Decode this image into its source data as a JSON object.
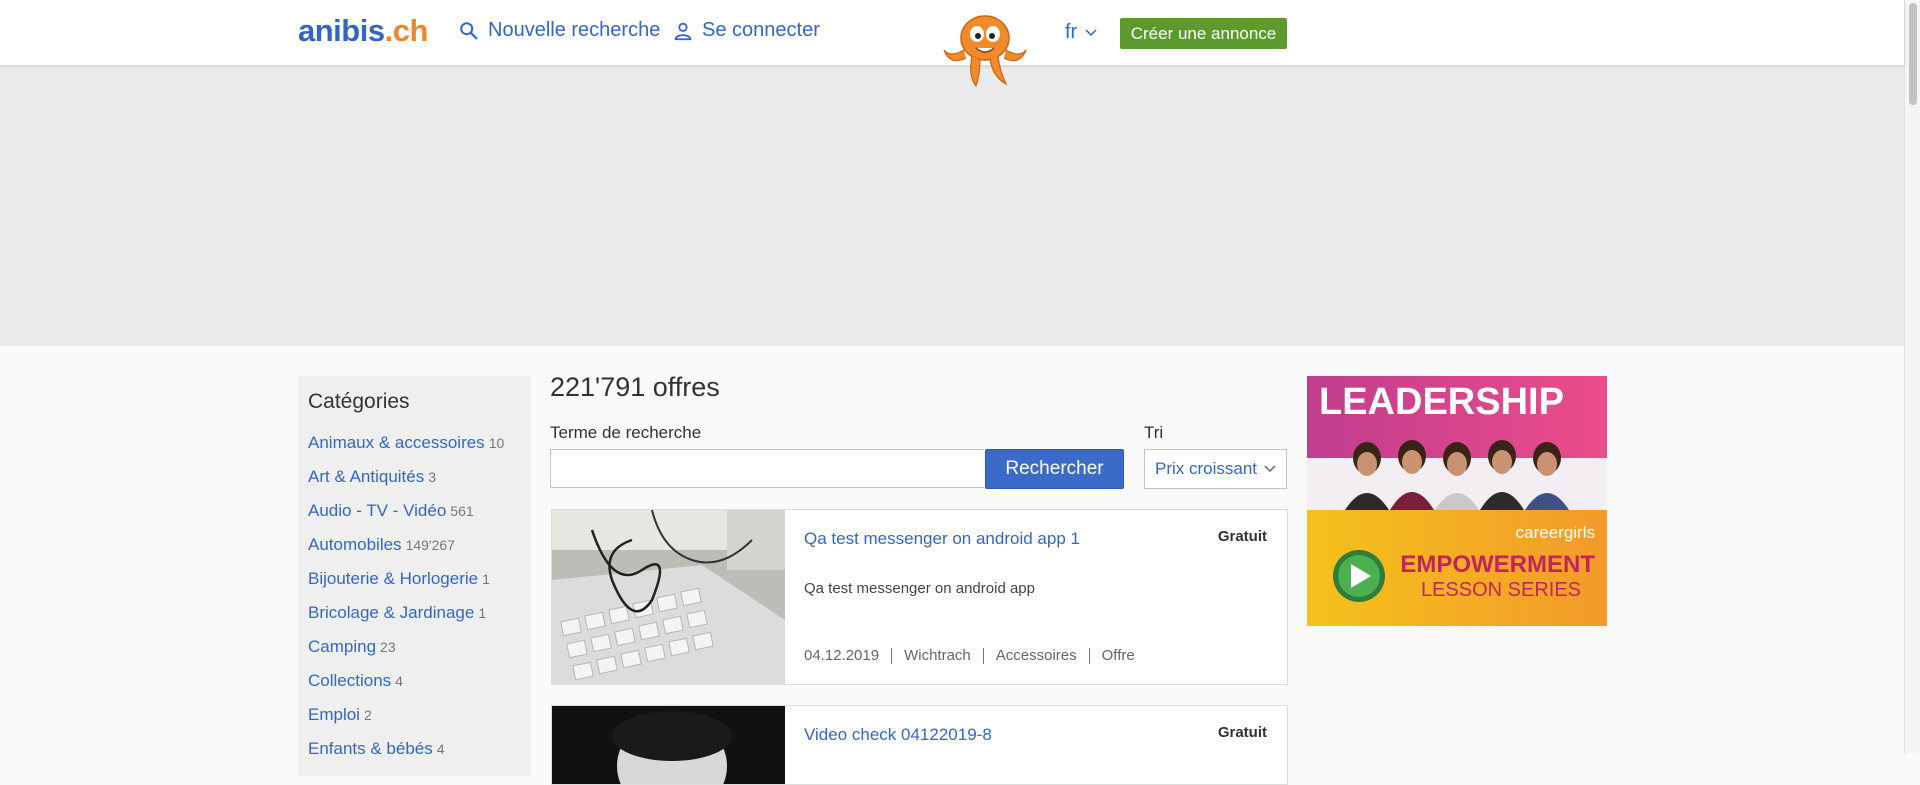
{
  "header": {
    "logo_part1": "anibis",
    "logo_part2": ".ch",
    "new_search": "Nouvelle recherche",
    "login": "Se connecter",
    "language": "fr",
    "create_ad": "Créer une annonce"
  },
  "sidebar": {
    "title": "Catégories",
    "categories": [
      {
        "label": "Animaux & accessoires",
        "count": "10"
      },
      {
        "label": "Art & Antiquités",
        "count": "3"
      },
      {
        "label": "Audio - TV - Vidéo",
        "count": "561"
      },
      {
        "label": "Automobiles",
        "count": "149'267"
      },
      {
        "label": "Bijouterie & Horlogerie",
        "count": "1"
      },
      {
        "label": "Bricolage & Jardinage",
        "count": "1"
      },
      {
        "label": "Camping",
        "count": "23"
      },
      {
        "label": "Collections",
        "count": "4"
      },
      {
        "label": "Emploi",
        "count": "2"
      },
      {
        "label": "Enfants & bébés",
        "count": "4"
      }
    ]
  },
  "results": {
    "title": "221'791 offres",
    "search_label": "Terme de recherche",
    "search_value": "",
    "search_button": "Rechercher",
    "sort_label": "Tri",
    "sort_value": "Prix croissant"
  },
  "listings": [
    {
      "title": "Qa test messenger on android app 1",
      "price": "Gratuit",
      "description": "Qa test messenger on android app",
      "date": "04.12.2019",
      "location": "Wichtrach",
      "category": "Accessoires",
      "type": "Offre"
    },
    {
      "title": "Video check 04122019-8",
      "price": "Gratuit"
    }
  ],
  "ad": {
    "headline": "LEADERSHIP",
    "brand": "careergirls",
    "line1": "EMPOWERMENT",
    "line2": "LESSON SERIES"
  },
  "colors": {
    "link": "#3366cc",
    "brand_blue": "#3565c2",
    "brand_orange": "#f0862c",
    "create_button": "#5b9b2d",
    "search_button": "#3a6bc9"
  }
}
